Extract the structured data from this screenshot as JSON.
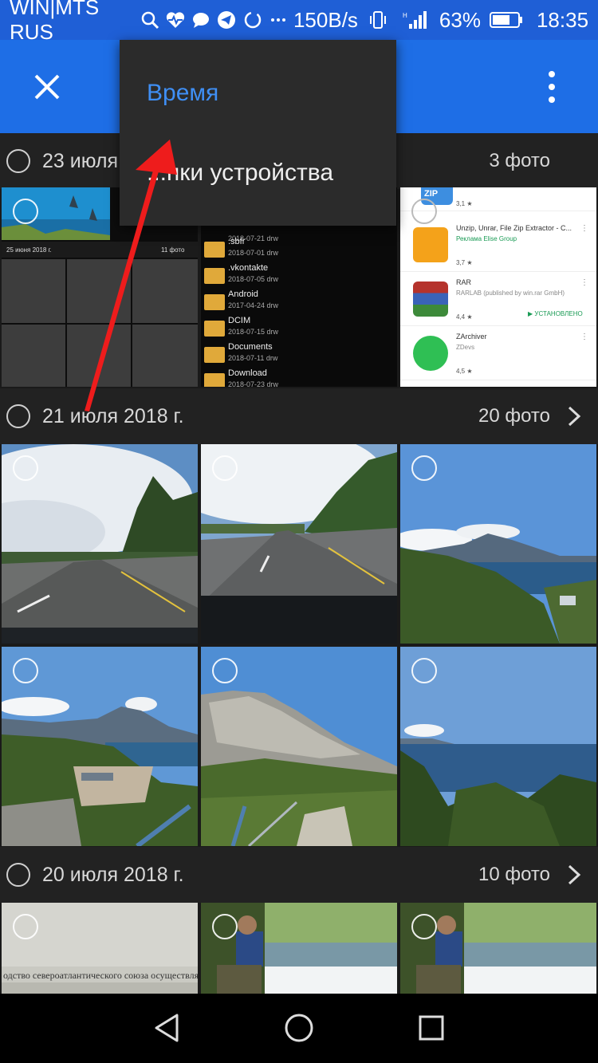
{
  "status_bar": {
    "carrier": "WIN|MTS RUS",
    "speed": "150B/s",
    "battery": "63%",
    "time": "18:35"
  },
  "app_bar": {
    "close_icon": "close-icon",
    "more_icon": "more-vert-icon"
  },
  "dropdown": {
    "selected": "Время",
    "other": "...пки устройства"
  },
  "groups": [
    {
      "date": "23 июля",
      "count": "3 фото"
    },
    {
      "date": "21 июля 2018 г.",
      "count": "20 фото"
    },
    {
      "date": "20 июля 2018 г.",
      "count": "10 фото"
    }
  ],
  "screenshot1": {
    "header": "25 июня 2018 г.",
    "count": "11 фото"
  },
  "file_manager": {
    "rows": [
      {
        "name": "",
        "date": "2018-07-21 drw"
      },
      {
        "name": ".sbfr",
        "date": "2018-07-01 drw"
      },
      {
        "name": ".vkontakte",
        "date": "2018-07-05 drw"
      },
      {
        "name": "Android",
        "date": "2017-04-24 drw"
      },
      {
        "name": "DCIM",
        "date": "2018-07-15 drw"
      },
      {
        "name": "Documents",
        "date": "2018-07-11 drw"
      },
      {
        "name": "Download",
        "date": "2018-07-23 drw"
      }
    ]
  },
  "play_store": {
    "items": [
      {
        "title": "",
        "line2": "",
        "line3": "",
        "rating": "3,1 ★",
        "badge": ""
      },
      {
        "title": "Unzip, Unrar, File Zip Extractor - C...",
        "line2": "Реклама  Elise Group",
        "line3": "",
        "rating": "3,7 ★",
        "badge": ""
      },
      {
        "title": "RAR",
        "line2": "RARLAB (published by win.rar GmbH)",
        "line3": "",
        "rating": "4,4 ★",
        "badge": "▶ УСТАНОВЛЕНО"
      },
      {
        "title": "ZArchiver",
        "line2": "ZDevs",
        "line3": "",
        "rating": "4,5 ★",
        "badge": ""
      }
    ]
  },
  "zip_label": "ZIP",
  "doc_text": "одство североатлантического союза осуществля",
  "nav": {
    "back": "back-icon",
    "home": "home-icon",
    "recents": "recents-icon"
  },
  "colors": {
    "status_bar": "#1f5fd6",
    "app_bar": "#1e6ee6",
    "dropdown_bg": "#2b2b2b",
    "selected_option": "#3f8ff5",
    "arrow": "#ee1c1c"
  }
}
